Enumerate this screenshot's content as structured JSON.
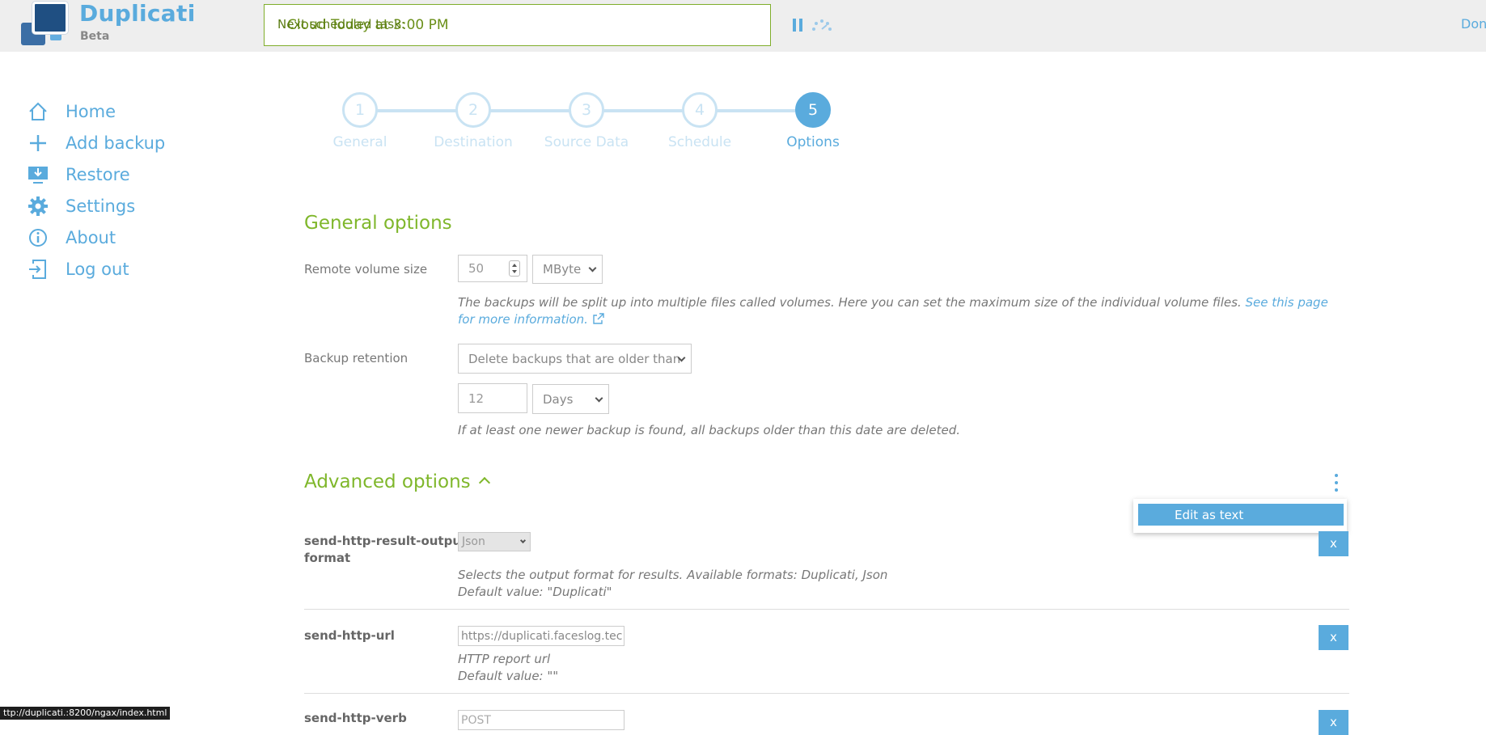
{
  "app": {
    "name": "Duplicati",
    "channel": "Beta"
  },
  "header": {
    "schedule_label": "Next scheduled task:",
    "schedule_value": "Cloud Today at 3:00 PM",
    "donate": "Dona"
  },
  "sidebar": {
    "items": [
      {
        "label": "Home",
        "icon": "home-icon"
      },
      {
        "label": "Add backup",
        "icon": "plus-icon"
      },
      {
        "label": "Restore",
        "icon": "restore-icon"
      },
      {
        "label": "Settings",
        "icon": "gear-icon"
      },
      {
        "label": "About",
        "icon": "info-icon"
      },
      {
        "label": "Log out",
        "icon": "logout-icon"
      }
    ]
  },
  "steps": [
    {
      "number": "1",
      "label": "General"
    },
    {
      "number": "2",
      "label": "Destination"
    },
    {
      "number": "3",
      "label": "Source Data"
    },
    {
      "number": "4",
      "label": "Schedule"
    },
    {
      "number": "5",
      "label": "Options",
      "active": true
    }
  ],
  "general": {
    "title": "General options",
    "volume": {
      "label": "Remote volume size",
      "value": "50",
      "unit": "MByte",
      "help": "The backups will be split up into multiple files called volumes. Here you can set the maximum size of the individual volume files.",
      "link": "See this page for more information."
    },
    "retention": {
      "label": "Backup retention",
      "mode": "Delete backups that are older than",
      "value": "12",
      "unit": "Days",
      "help": "If at least one newer backup is found, all backups older than this date are deleted."
    }
  },
  "advanced": {
    "title": "Advanced options",
    "menu_item": "Edit as text",
    "options": [
      {
        "name_line1": "send-http-result-output-",
        "name_line2": "format",
        "value": "Json",
        "help1": "Selects the output format for results. Available formats: Duplicati, Json",
        "help2": "Default value: \"Duplicati\"",
        "remove": "x"
      },
      {
        "name_line1": "send-http-url",
        "value": "https://duplicati.faceslog.tec",
        "help1": "HTTP report url",
        "help2": "Default value: \"\"",
        "remove": "x"
      },
      {
        "name_line1": "send-http-verb",
        "value": "POST",
        "remove": "x"
      }
    ]
  },
  "statusbar": {
    "url": "ttp://duplicati.:8200/ngax/index.html"
  },
  "colors": {
    "accent": "#5aabdd",
    "green": "#7fb72b",
    "step_inactive": "#c9e3f3"
  }
}
